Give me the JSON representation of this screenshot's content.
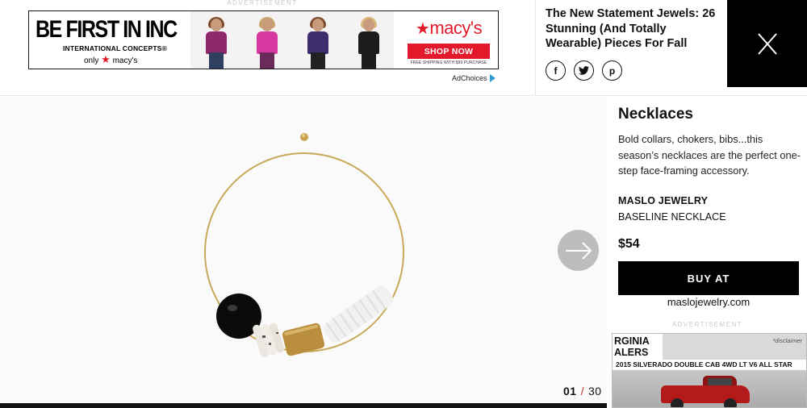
{
  "top_ad": {
    "label": "ADVERTISEMENT",
    "inc_title": "BE FIRST IN INC",
    "inc_subtitle": "INTERNATIONAL CONCEPTS®",
    "inc_only": "only",
    "inc_only_brand": "macy's",
    "macys_logo": "macy's",
    "shop_now": "SHOP NOW",
    "free_shipping": "FREE SHIPPING WITH $99 PURCHASE",
    "adchoices": "AdChoices"
  },
  "article": {
    "headline": "The New Statement Jewels: 26 Stunning (And Totally Wearable) Pieces For Fall"
  },
  "share": {
    "facebook": "f",
    "twitter": "t",
    "pinterest": "p"
  },
  "slide": {
    "current": "01",
    "separator": "/",
    "total": "30"
  },
  "sidebar": {
    "title": "Necklaces",
    "description": "Bold collars, chokers, bibs...this season’s necklaces are the perfect one-step face-framing accessory.",
    "brand": "MASLO JEWELRY",
    "product": "BASELINE NECKLACE",
    "price": "$54",
    "buy_label": "BUY AT",
    "retailer": "maslojewelry.com",
    "ad_label": "ADVERTISEMENT"
  },
  "side_ad": {
    "dealer_line1": "RGINIA",
    "dealer_line2": "ALERS",
    "disclaimer": "*disclaimer",
    "model": "2015 SILVERADO DOUBLE CAB 4WD LT V6 ALL STAR"
  },
  "colors": {
    "accent_red": "#e21a2c",
    "counter_separator": "#c0392b",
    "buy_button": "#000000",
    "next_button": "#bdbdbd"
  },
  "icons": [
    "facebook-icon",
    "twitter-icon",
    "pinterest-icon",
    "close-icon",
    "arrow-right-icon",
    "adchoices-icon"
  ]
}
